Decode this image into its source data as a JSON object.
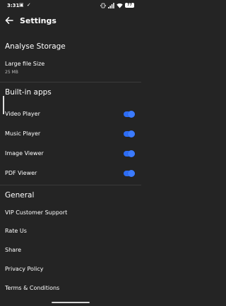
{
  "status_bar": {
    "time": "3:31",
    "battery": "77",
    "left_icons": "▣ ✓",
    "colors": {
      "text": "#ffffff"
    }
  },
  "app_bar": {
    "title": "Settings",
    "back_icon": "arrow-back-icon"
  },
  "sections": {
    "analyse_storage": {
      "header": "Analyse Storage",
      "items": [
        {
          "label": "Large file Size",
          "value": "25 MB"
        }
      ]
    },
    "builtin_apps": {
      "header": "Built-in apps",
      "items": [
        {
          "label": "Video Player",
          "enabled": true
        },
        {
          "label": "Music Player",
          "enabled": true
        },
        {
          "label": "Image Viewer",
          "enabled": true
        },
        {
          "label": "PDF Viewer",
          "enabled": true
        }
      ]
    },
    "general": {
      "header": "General",
      "items": [
        {
          "label": "VIP Customer Support"
        },
        {
          "label": "Rate Us"
        },
        {
          "label": "Share"
        },
        {
          "label": "Privacy Policy"
        },
        {
          "label": "Terms & Conditions"
        }
      ]
    }
  },
  "colors": {
    "background": "#242424",
    "accent": "#2d6df5",
    "divider": "#3a3a3a",
    "secondary_text": "#bdbdbd"
  }
}
